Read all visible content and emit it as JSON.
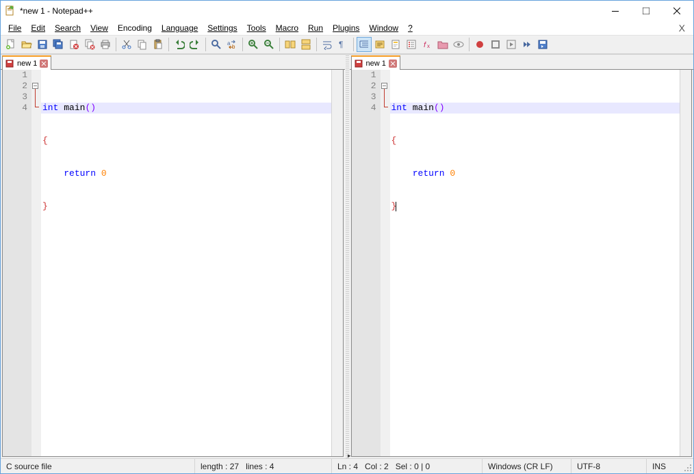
{
  "window": {
    "title": "*new 1 - Notepad++"
  },
  "menus": {
    "file": "File",
    "edit": "Edit",
    "search": "Search",
    "view": "View",
    "encoding": "Encoding",
    "language": "Language",
    "settings": "Settings",
    "tools": "Tools",
    "macro": "Macro",
    "run": "Run",
    "plugins": "Plugins",
    "window": "Window",
    "help": "?"
  },
  "tabs": {
    "left": {
      "label": "new 1"
    },
    "right": {
      "label": "new 1"
    }
  },
  "code": {
    "lines": [
      {
        "n": "1"
      },
      {
        "n": "2"
      },
      {
        "n": "3"
      },
      {
        "n": "4"
      }
    ],
    "l1_kw": "int",
    "l1_sp": " ",
    "l1_fn": "main",
    "l1_paren": "()",
    "l2_brace": "{",
    "l3_indent": "    ",
    "l3_kw": "return",
    "l3_sp": " ",
    "l3_num": "0",
    "l4_brace": "}"
  },
  "statusbar": {
    "filetype": "C source file",
    "length": "length : 27",
    "lines": "lines : 4",
    "ln": "Ln : 4",
    "col": "Col : 2",
    "sel": "Sel : 0 | 0",
    "eol": "Windows (CR LF)",
    "encoding": "UTF-8",
    "mode": "INS"
  }
}
